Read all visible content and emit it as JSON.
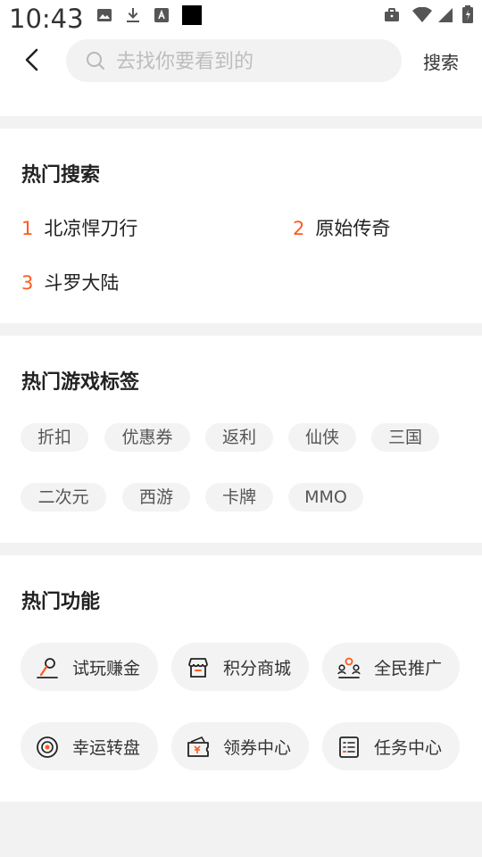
{
  "status_bar": {
    "time": "10:43"
  },
  "search": {
    "placeholder": "去找你要看到的",
    "button": "搜索"
  },
  "hot_search": {
    "title": "热门搜索",
    "items": [
      {
        "rank": "1",
        "label": "北凉悍刀行"
      },
      {
        "rank": "2",
        "label": "原始传奇"
      },
      {
        "rank": "3",
        "label": "斗罗大陆"
      }
    ]
  },
  "hot_tags": {
    "title": "热门游戏标签",
    "tags": [
      "折扣",
      "优惠券",
      "返利",
      "仙侠",
      "三国",
      "二次元",
      "西游",
      "卡牌",
      "MMO"
    ]
  },
  "hot_functions": {
    "title": "热门功能",
    "items": [
      {
        "icon": "trial-play-icon",
        "label": "试玩赚金"
      },
      {
        "icon": "shop-icon",
        "label": "积分商城"
      },
      {
        "icon": "promote-icon",
        "label": "全民推广"
      },
      {
        "icon": "wheel-icon",
        "label": "幸运转盘"
      },
      {
        "icon": "coupon-icon",
        "label": "领券中心"
      },
      {
        "icon": "task-list-icon",
        "label": "任务中心"
      }
    ]
  },
  "colors": {
    "accent": "#ff5a1f",
    "tag_bg": "#f3f3f3",
    "page_bg": "#f2f2f2"
  }
}
